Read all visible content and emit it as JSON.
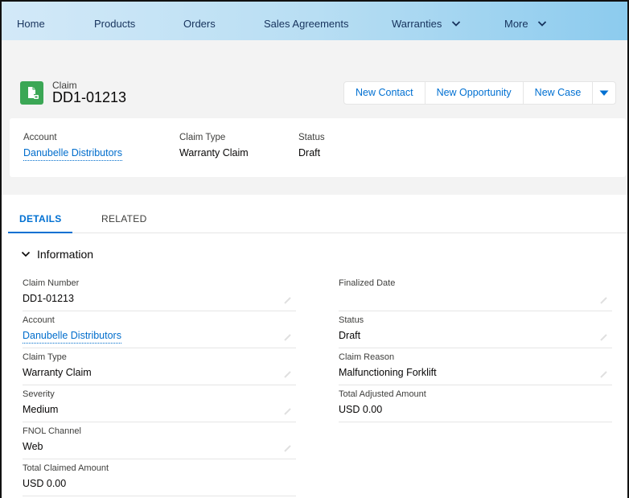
{
  "nav": {
    "items": [
      {
        "label": "Home",
        "has_dropdown": false
      },
      {
        "label": "Products",
        "has_dropdown": false
      },
      {
        "label": "Orders",
        "has_dropdown": false
      },
      {
        "label": "Sales Agreements",
        "has_dropdown": false
      },
      {
        "label": "Warranties",
        "has_dropdown": true
      },
      {
        "label": "More",
        "has_dropdown": true
      }
    ]
  },
  "record": {
    "object_type": "Claim",
    "name": "DD1-01213",
    "icon": "claim-icon",
    "icon_color": "#3ba755"
  },
  "actions": {
    "buttons": [
      "New Contact",
      "New Opportunity",
      "New Case"
    ],
    "more_icon": "chevron-down-icon"
  },
  "highlights": [
    {
      "label": "Account",
      "value": "Danubelle Distributors",
      "is_link": true
    },
    {
      "label": "Claim Type",
      "value": "Warranty Claim",
      "is_link": false
    },
    {
      "label": "Status",
      "value": "Draft",
      "is_link": false
    }
  ],
  "tabs": [
    {
      "label": "DETAILS",
      "active": true
    },
    {
      "label": "RELATED",
      "active": false
    }
  ],
  "section": {
    "title": "Information",
    "expanded": true
  },
  "fields_left": [
    {
      "label": "Claim Number",
      "value": "DD1-01213",
      "is_link": false,
      "editable": true
    },
    {
      "label": "Account",
      "value": "Danubelle Distributors",
      "is_link": true,
      "editable": true
    },
    {
      "label": "Claim Type",
      "value": "Warranty Claim",
      "is_link": false,
      "editable": true
    },
    {
      "label": "Severity",
      "value": "Medium",
      "is_link": false,
      "editable": true
    },
    {
      "label": "FNOL Channel",
      "value": "Web",
      "is_link": false,
      "editable": true
    },
    {
      "label": "Total Claimed Amount",
      "value": "USD 0.00",
      "is_link": false,
      "editable": false
    }
  ],
  "fields_right": [
    {
      "label": "Finalized Date",
      "value": "",
      "is_link": false,
      "editable": true
    },
    {
      "label": "Status",
      "value": "Draft",
      "is_link": false,
      "editable": true
    },
    {
      "label": "Claim Reason",
      "value": "Malfunctioning Forklift",
      "is_link": false,
      "editable": true
    },
    {
      "label": "Total Adjusted Amount",
      "value": "USD 0.00",
      "is_link": false,
      "editable": false
    }
  ],
  "colors": {
    "link": "#006dcc",
    "brand": "#0070d2",
    "nav_text": "#16325c"
  }
}
